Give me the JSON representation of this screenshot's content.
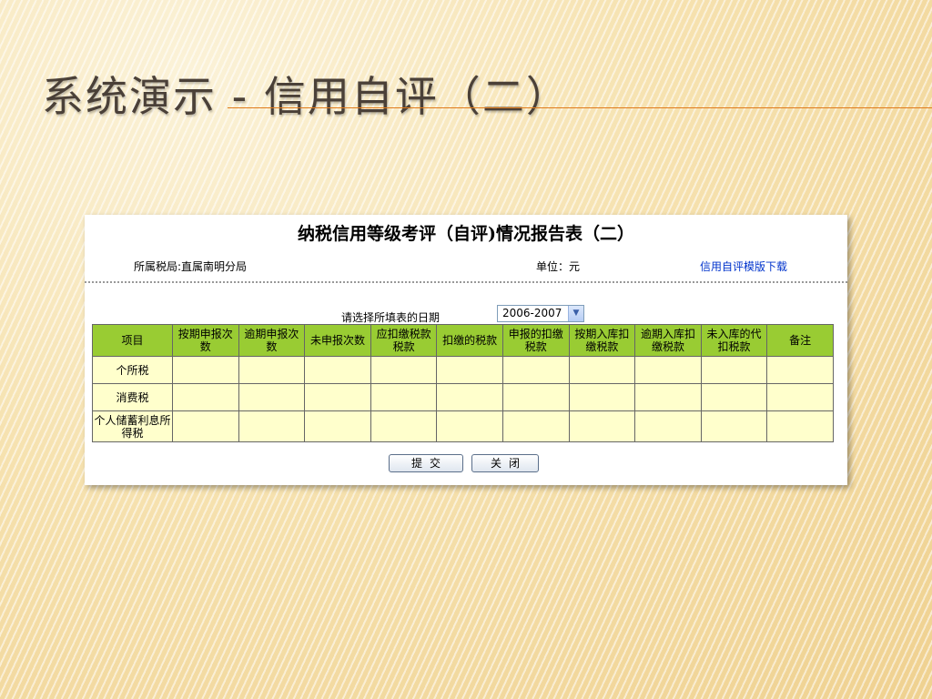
{
  "slide": {
    "title": "系统演示 - 信用自评（二）"
  },
  "report": {
    "title": "纳税信用等级考评（自评)情况报告表（二）",
    "tax_bureau_label": "所属税局:直属南明分局",
    "unit_label": "单位：元",
    "download_link": "信用自评模版下载",
    "date_prompt": "请选择所填表的日期",
    "date_selected": "2006-2007",
    "columns": [
      "项目",
      "按期申报次数",
      "逾期申报次数",
      "未申报次数",
      "应扣缴税款税款",
      "扣缴的税款",
      "申报的扣缴税款",
      "按期入库扣缴税款",
      "逾期入库扣缴税款",
      "未入库的代扣税款",
      "备注"
    ],
    "rows": [
      "个所税",
      "消费税",
      "个人储蓄利息所得税"
    ],
    "submit_label": "提交",
    "close_label": "关闭"
  }
}
